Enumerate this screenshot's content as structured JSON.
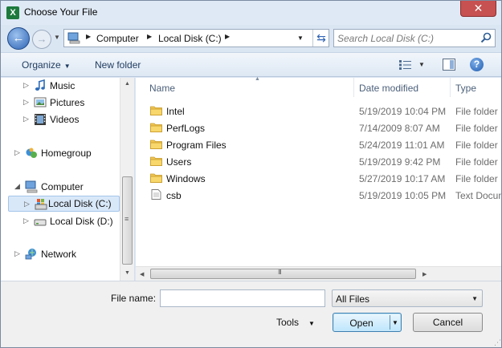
{
  "window": {
    "title": "Choose Your File",
    "app_icon_letter": "X",
    "close_glyph": "✕"
  },
  "address": {
    "breadcrumbs": [
      "Computer",
      "Local Disk (C:)"
    ],
    "search_placeholder": "Search Local Disk (C:)"
  },
  "toolbar": {
    "organize_label": "Organize",
    "new_folder_label": "New folder",
    "help_glyph": "?"
  },
  "nav": {
    "items": [
      {
        "label": "Music",
        "icon": "music-icon"
      },
      {
        "label": "Pictures",
        "icon": "pictures-icon"
      },
      {
        "label": "Videos",
        "icon": "videos-icon"
      },
      {
        "label": "Homegroup",
        "icon": "homegroup-icon"
      },
      {
        "label": "Computer",
        "icon": "computer-icon"
      },
      {
        "label": "Local Disk (C:)",
        "icon": "drive-icon"
      },
      {
        "label": "Local Disk (D:)",
        "icon": "drive-icon"
      },
      {
        "label": "Network",
        "icon": "network-icon"
      }
    ]
  },
  "files": {
    "columns": [
      "Name",
      "Date modified",
      "Type"
    ],
    "rows": [
      {
        "name": "Intel",
        "date": "5/19/2019 10:04 PM",
        "type": "File folder",
        "icon": "folder-icon"
      },
      {
        "name": "PerfLogs",
        "date": "7/14/2009 8:07 AM",
        "type": "File folder",
        "icon": "folder-icon"
      },
      {
        "name": "Program Files",
        "date": "5/24/2019 11:01 AM",
        "type": "File folder",
        "icon": "folder-icon"
      },
      {
        "name": "Users",
        "date": "5/19/2019 9:42 PM",
        "type": "File folder",
        "icon": "folder-icon"
      },
      {
        "name": "Windows",
        "date": "5/27/2019 10:17 AM",
        "type": "File folder",
        "icon": "folder-icon"
      },
      {
        "name": "csb",
        "date": "5/19/2019 10:05 PM",
        "type": "Text Document",
        "icon": "text-file-icon"
      }
    ]
  },
  "footer": {
    "file_name_label": "File name:",
    "file_name_value": "",
    "filter_value": "All Files",
    "tools_label": "Tools",
    "open_label": "Open",
    "cancel_label": "Cancel"
  }
}
